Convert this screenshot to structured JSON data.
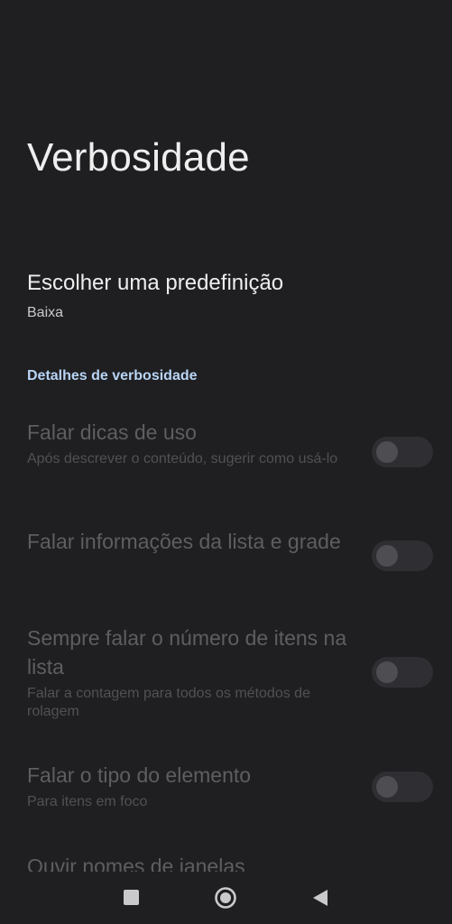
{
  "header": {
    "title": "Verbosidade"
  },
  "preset": {
    "title": "Escolher uma predefinição",
    "value": "Baixa"
  },
  "section": {
    "title": "Detalhes de verbosidade"
  },
  "settings": [
    {
      "title": "Falar dicas de uso",
      "summary": "Após descrever o conteúdo, sugerir como usá-lo",
      "enabled": false
    },
    {
      "title": "Falar informações da lista e grade",
      "summary": "",
      "enabled": false
    },
    {
      "title": "Sempre falar o número de itens na lista",
      "summary": "Falar a contagem para todos os métodos de rolagem",
      "enabled": false
    },
    {
      "title": "Falar o tipo do elemento",
      "summary": "Para itens em foco",
      "enabled": false
    },
    {
      "title": "Ouvir nomes de janelas",
      "summary": "",
      "enabled": false
    }
  ],
  "nav": {
    "icons": [
      "recents-icon",
      "home-icon",
      "back-icon"
    ]
  },
  "colors": {
    "background": "#1f1f21",
    "accent": "#b8d4f5",
    "disabled_text": "#5e5e62"
  }
}
